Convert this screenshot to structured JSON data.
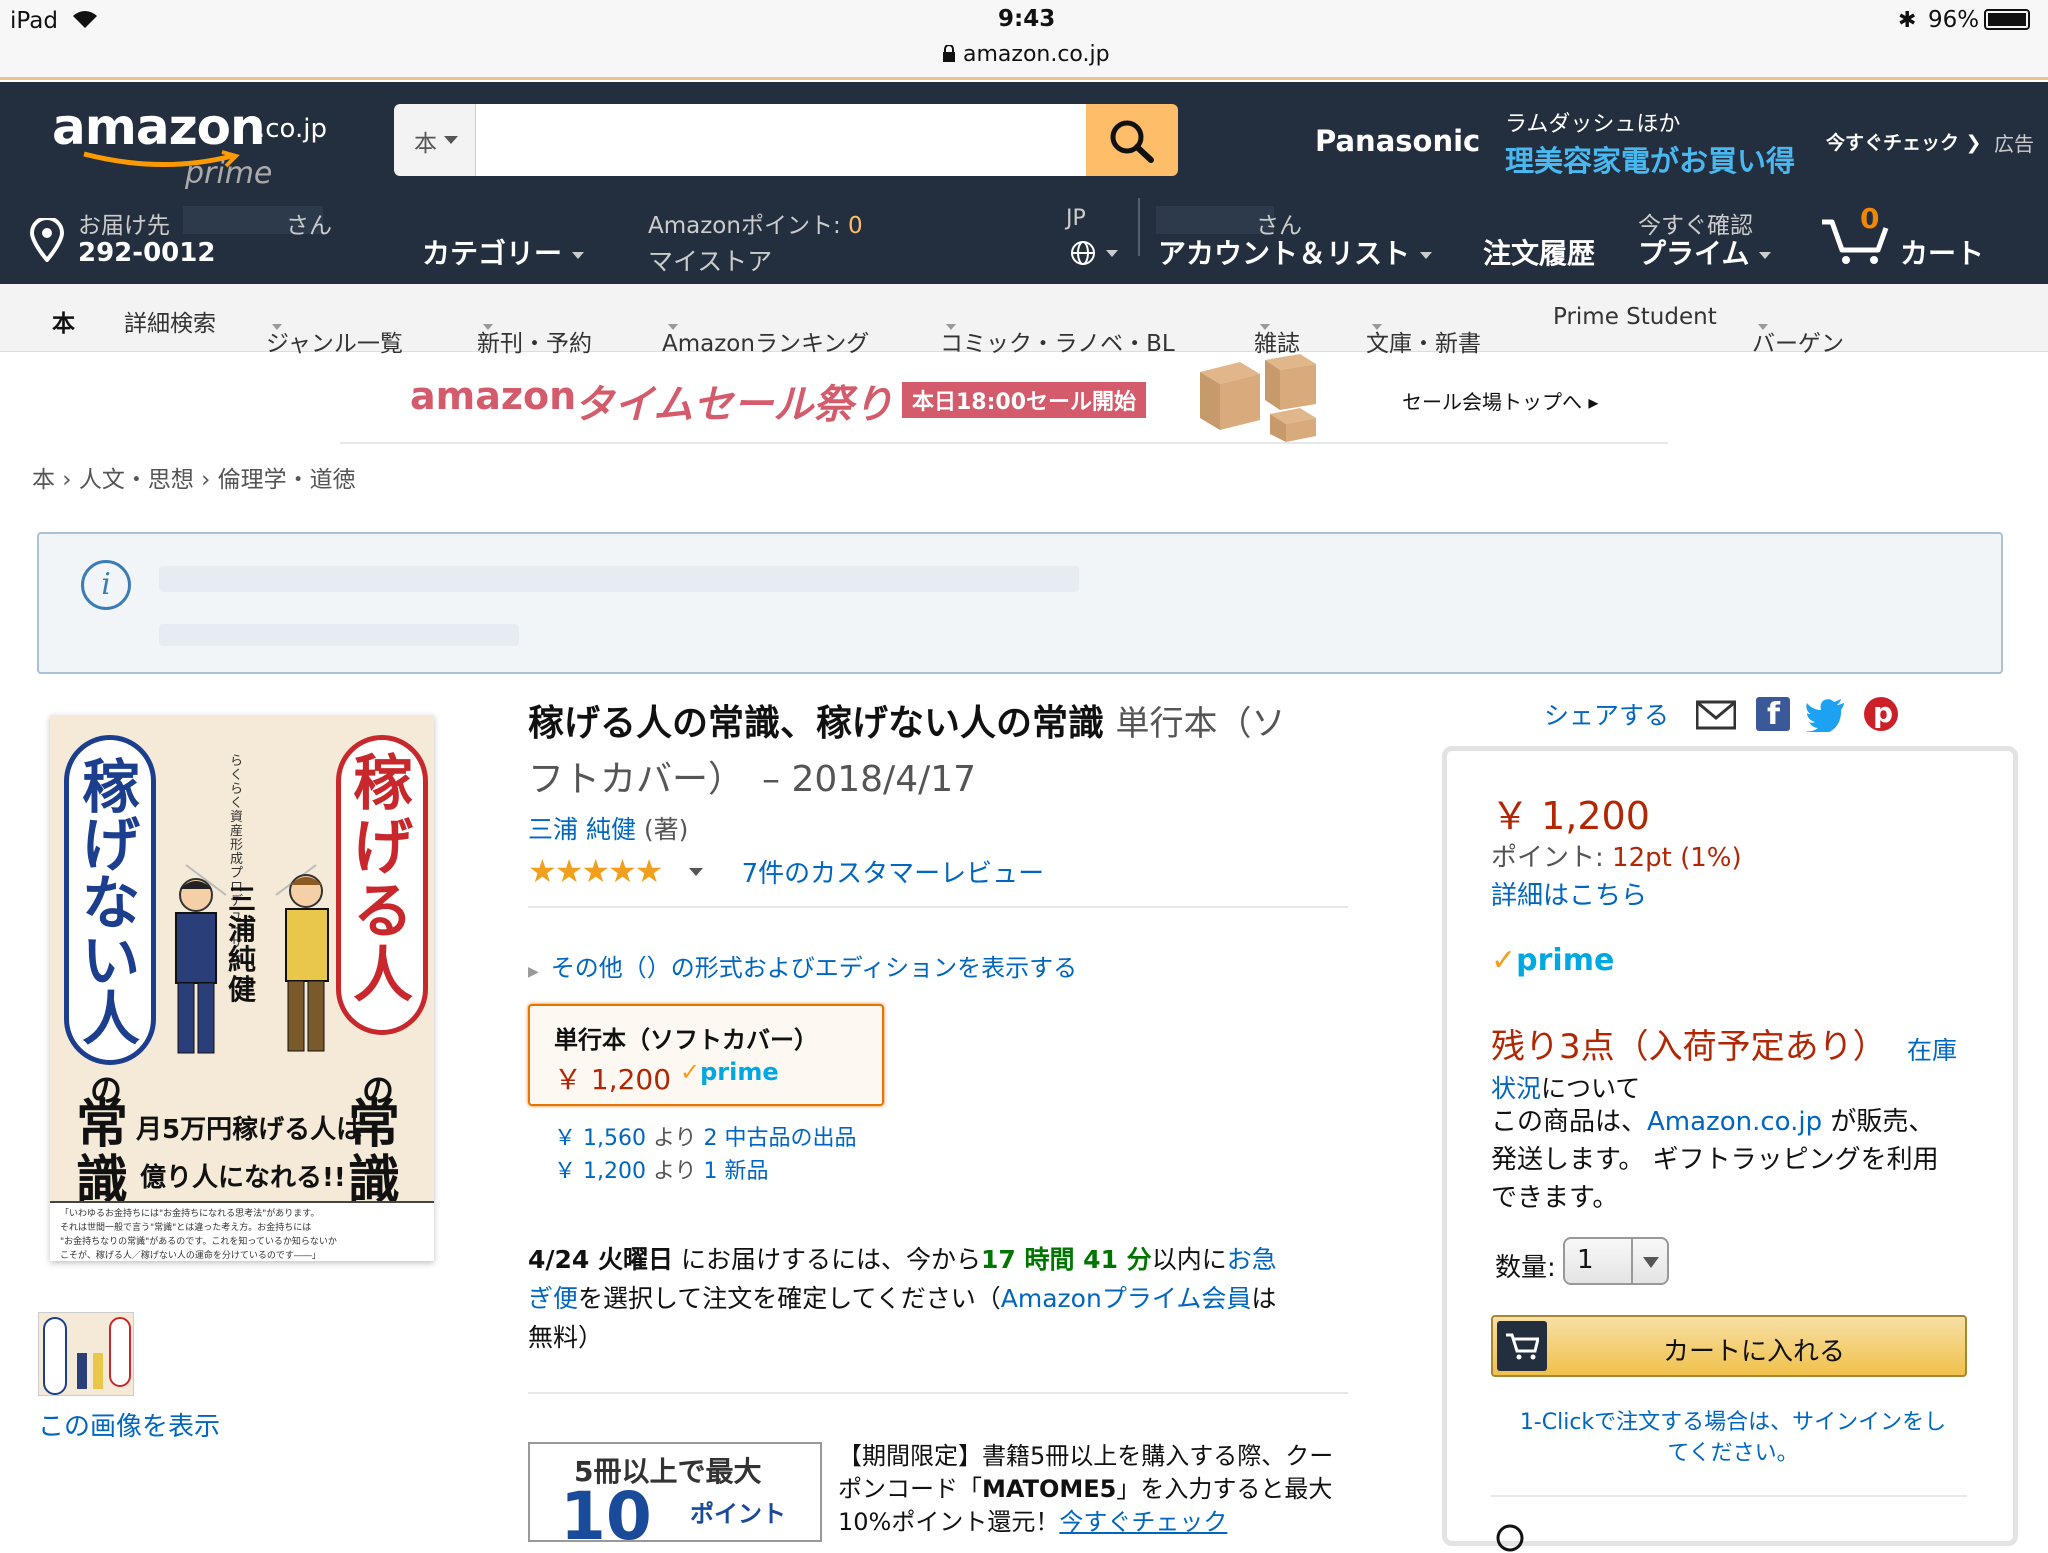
{
  "status_bar": {
    "device": "iPad",
    "time": "9:43",
    "url": "amazon.co.jp",
    "battery": "96%"
  },
  "header": {
    "logo_text": "amazon",
    "logo_suffix": ".co.jp",
    "logo_prime": "prime",
    "search_category": "本",
    "search_value": "",
    "ad_brand": "Panasonic",
    "ad_line1": "ラムダッシュほか",
    "ad_line2": "理美容家電がお買い得",
    "ad_cta": "今すぐチェック",
    "ad_label": "広告",
    "deliver_label": "お届け先",
    "deliver_name_suffix": "さん",
    "deliver_zip": "292-0012",
    "category": "カテゴリー",
    "points_label": "Amazonポイント: ",
    "points_value": "0",
    "mystore": "マイストア",
    "lang": "JP",
    "account_top_suffix": "さん",
    "account": "アカウント＆リスト",
    "orders": "注文履歴",
    "prime_top": "今すぐ確認",
    "prime": "プライム",
    "cart_count": "0",
    "cart": "カート"
  },
  "subnav": {
    "items": [
      "本",
      "詳細検索",
      "ジャンル一覧",
      "新刊・予約",
      "Amazonランキング",
      "コミック・ラノベ・BL",
      "雑誌",
      "文庫・新書",
      "Prime Student",
      "バーゲン"
    ]
  },
  "banner": {
    "title_a": "amazon",
    "title_b": "タイムセール祭り",
    "badge": "本日18:00セール開始",
    "link": "セール会場トップへ"
  },
  "breadcrumb": [
    "本",
    "人文・思想",
    "倫理学・道徳"
  ],
  "info_icon": "i",
  "product": {
    "title": "稼げる人の常識、稼げない人の常識",
    "format_line1": "単行本（ソ",
    "format_line2": "フトカバー）　– 2018/4/17",
    "author": "三浦 純健",
    "author_role": "(著)",
    "reviews": "7件のカスタマーレビュー",
    "other_formats": "その他（）の形式およびエディションを表示する",
    "format_box_title": "単行本（ソフトカバー）",
    "format_box_price": "￥ 1,200",
    "format_box_prime": "prime",
    "used_price": "￥ 1,560",
    "used_from": "より",
    "used_link": "2 中古品の出品",
    "new_price": "￥ 1,200",
    "new_from": "より",
    "new_link": "1 新品",
    "delivery_date": "4/24 火曜日",
    "delivery_text1": " にお届けするには、今から",
    "delivery_countdown": "17 時間 41 分",
    "delivery_text2": "以内に",
    "delivery_link1a": "お急",
    "delivery_link1b": "ぎ便",
    "delivery_text3": "を選択して注文を確定してください（",
    "delivery_link2": "Amazonプライム会員",
    "delivery_text4": "は",
    "delivery_text5": "無料）",
    "promo_img_line1": "5冊以上で最大",
    "promo_img_big": "10",
    "promo_img_small": "ポイント",
    "promo_line1": "【期間限定】書籍5冊以上を購入する際、クー",
    "promo_line2a": "ポンコード「",
    "promo_code": "MATOME5",
    "promo_line2b": "」を入力すると最大",
    "promo_line3": "10%ポイント還元！",
    "promo_link": "今すぐチェック",
    "view_image": "この画像を表示"
  },
  "cover": {
    "left_title": "稼げない人",
    "right_title": "稼げる人",
    "no": "の",
    "joshiki": "常識",
    "author_vertical": "三浦純健",
    "sub_vertical": "らくらく資産形成プロデューサー",
    "band1": "月5万円稼げる人は",
    "band2": "億り人になれる!!",
    "fine1": "「いわゆるお金持ちには\"お金持ちになれる思考法\"があります。",
    "fine2": "それは世間一般で言う\"常識\"とは違った考え方。お金持ちには",
    "fine3": "\"お金持ちなりの常識\"があるのです。これを知っているか知らないか",
    "fine4": "こそが、稼げる人／稼げない人の運命を分けているのです――」"
  },
  "share": {
    "label": "シェアする"
  },
  "buybox": {
    "price": "￥ 1,200",
    "points_label": "ポイント: ",
    "points_value": "12pt (1%)",
    "details_link": "詳細はこちら",
    "prime": "prime",
    "stock": "残り3点（入荷予定あり）",
    "stock_link_a": "在庫",
    "stock_link_b": "状況",
    "stock_after": "について",
    "sold_line1a": "この商品は、",
    "sold_link": "Amazon.co.jp",
    "sold_line1b": " が販売、",
    "sold_line2": "発送します。 ギフトラッピングを利用",
    "sold_line3": "できます。",
    "qty_label": "数量:",
    "qty_value": "1",
    "add_to_cart": "カートに入れる",
    "oneclick_line1": "1-Clickで注文する場合は、サインインをし",
    "oneclick_line2": "てください。"
  },
  "colors": {
    "header_bg": "#232f3e",
    "accent": "#febd69",
    "link": "#0066c0",
    "price": "#b12704",
    "countdown": "#007600",
    "cart_button": "#f0c14b"
  }
}
